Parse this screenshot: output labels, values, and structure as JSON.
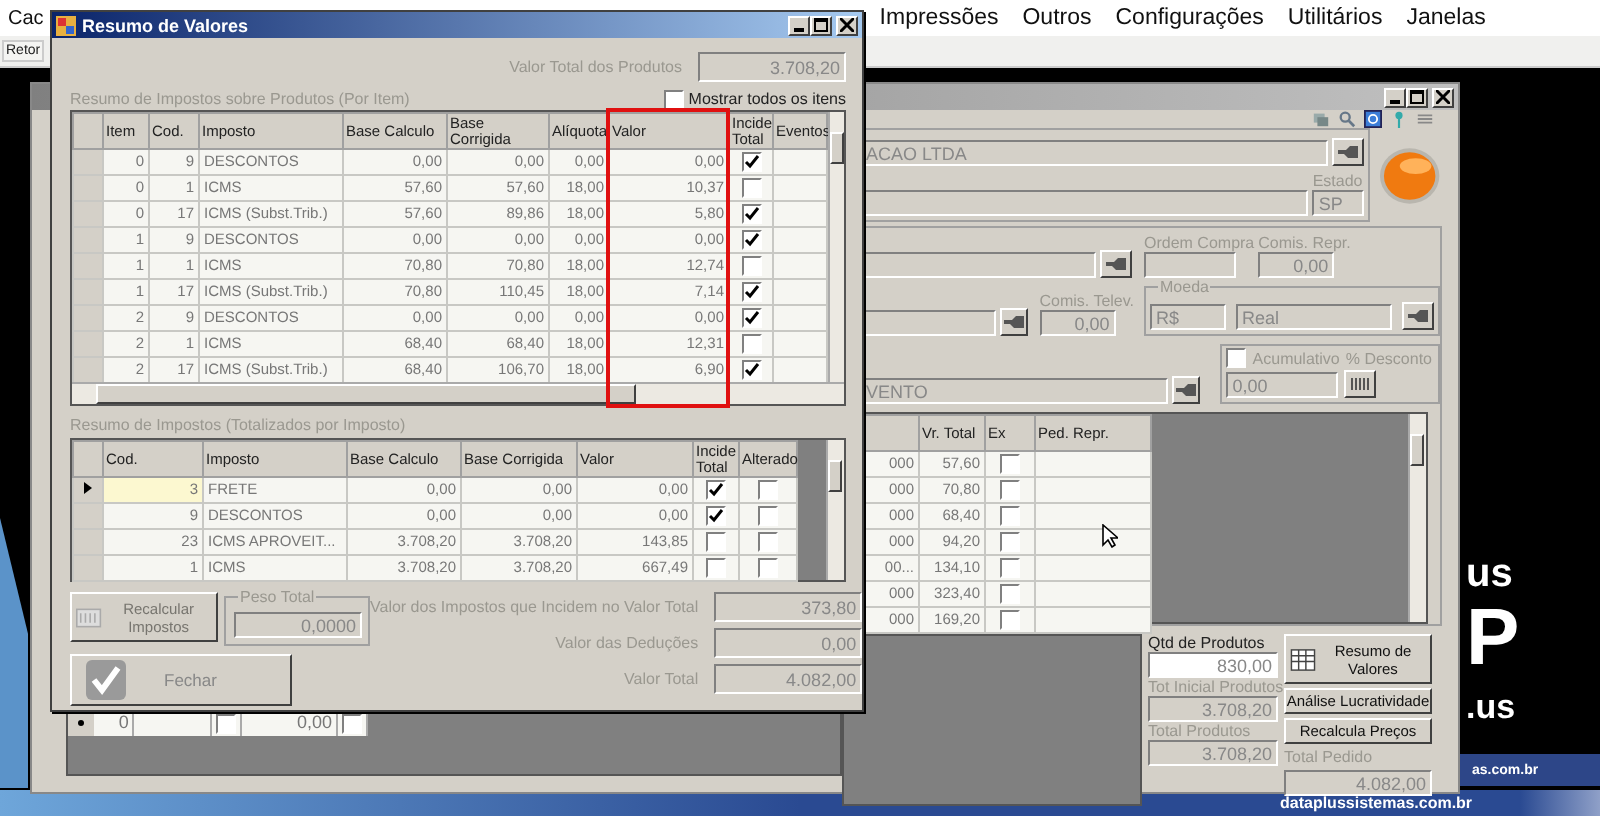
{
  "app": {
    "menu_cut": "Cac",
    "menu": [
      "Impressões",
      "Outros",
      "Configurações",
      "Utilitários",
      "Janelas"
    ],
    "toolbar_button": "Retor"
  },
  "wallpaper": {
    "logo_top": "us",
    "logo_mid": "P",
    "logo_bottom": ".us",
    "band_text": "as.com.br",
    "footer": "dataplussistemas.com.br"
  },
  "order_window": {
    "company": "ACAO LTDA",
    "estado_label": "Estado",
    "estado": "SP",
    "ordem_compra_label": "Ordem Compra",
    "comis_repr_label": "Comis. Repr.",
    "comis_repr": "0,00",
    "comis_telev_label": "Comis. Telev.",
    "comis_telev": "0,00",
    "moeda_label": "Moeda",
    "moeda_code": "R$",
    "moeda_name": "Real",
    "field_cut": "VENTO",
    "acumulativo": {
      "label": "Acumulativo",
      "checked": false
    },
    "desconto_label": "% Desconto",
    "desconto": "0,00",
    "grid": {
      "columns": [
        "Vr. Total",
        "Ex",
        "Ped. Repr."
      ],
      "rows": [
        {
          "column_1": "000",
          "total": "57,60",
          "ex": false
        },
        {
          "column_1": "000",
          "total": "70,80",
          "ex": false
        },
        {
          "column_1": "000",
          "total": "68,40",
          "ex": false
        },
        {
          "column_1": "000",
          "total": "94,20",
          "ex": false
        },
        {
          "column_1": "00...",
          "total": "134,10",
          "ex": false
        },
        {
          "column_1": "000",
          "total": "323,40",
          "ex": false
        },
        {
          "column_1": "000",
          "total": "169,20",
          "ex": false
        }
      ]
    },
    "lower_row": {
      "value": "0",
      "check_1": false,
      "amount": "0,00",
      "check_2": false
    },
    "qtd_label": "Qtd de Produtos",
    "qtd": "830,00",
    "tot_inicial_label": "Tot Inicial Produtos",
    "tot_inicial": "3.708,20",
    "total_produtos_label": "Total Produtos",
    "total_produtos": "3.708,20",
    "total_pedido_label": "Total Pedido",
    "total_pedido": "4.082,00",
    "buttons": {
      "resumo": "Resumo de Valores",
      "analise": "Análise Lucratividade",
      "recalcula": "Recalcula Preços"
    }
  },
  "dialog": {
    "title": "Resumo de Valores",
    "total_label": "Valor Total dos Produtos",
    "total": "3.708,20",
    "items_title": "Resumo de Impostos sobre Produtos (Por Item)",
    "show_all": {
      "label": "Mostrar todos os itens",
      "checked": false
    },
    "items_columns": [
      "Item",
      "Cod.",
      "Imposto",
      "Base Calculo",
      "Base Corrigida",
      "Alíquota",
      "Valor",
      "Incide Total",
      "Eventos"
    ],
    "items": [
      {
        "item": "0",
        "cod": "9",
        "imposto": "DESCONTOS",
        "base": "0,00",
        "corrigida": "0,00",
        "aliquota": "0,00",
        "valor": "0,00",
        "incide": true
      },
      {
        "item": "0",
        "cod": "1",
        "imposto": "ICMS",
        "base": "57,60",
        "corrigida": "57,60",
        "aliquota": "18,00",
        "valor": "10,37",
        "incide": false
      },
      {
        "item": "0",
        "cod": "17",
        "imposto": "ICMS (Subst.Trib.)",
        "base": "57,60",
        "corrigida": "89,86",
        "aliquota": "18,00",
        "valor": "5,80",
        "incide": true
      },
      {
        "item": "1",
        "cod": "9",
        "imposto": "DESCONTOS",
        "base": "0,00",
        "corrigida": "0,00",
        "aliquota": "0,00",
        "valor": "0,00",
        "incide": true
      },
      {
        "item": "1",
        "cod": "1",
        "imposto": "ICMS",
        "base": "70,80",
        "corrigida": "70,80",
        "aliquota": "18,00",
        "valor": "12,74",
        "incide": false
      },
      {
        "item": "1",
        "cod": "17",
        "imposto": "ICMS (Subst.Trib.)",
        "base": "70,80",
        "corrigida": "110,45",
        "aliquota": "18,00",
        "valor": "7,14",
        "incide": true
      },
      {
        "item": "2",
        "cod": "9",
        "imposto": "DESCONTOS",
        "base": "0,00",
        "corrigida": "0,00",
        "aliquota": "0,00",
        "valor": "0,00",
        "incide": true
      },
      {
        "item": "2",
        "cod": "1",
        "imposto": "ICMS",
        "base": "68,40",
        "corrigida": "68,40",
        "aliquota": "18,00",
        "valor": "12,31",
        "incide": false
      },
      {
        "item": "2",
        "cod": "17",
        "imposto": "ICMS (Subst.Trib.)",
        "base": "68,40",
        "corrigida": "106,70",
        "aliquota": "18,00",
        "valor": "6,90",
        "incide": true
      }
    ],
    "totals_title": "Resumo de Impostos (Totalizados por Imposto)",
    "totals_columns": [
      "Cod.",
      "Imposto",
      "Base Calculo",
      "Base Corrigida",
      "Valor",
      "Incide Total",
      "Alterado"
    ],
    "totals_rows": [
      {
        "cod": "3",
        "imposto": "FRETE",
        "base": "0,00",
        "corrigida": "0,00",
        "valor": "0,00",
        "incide": true,
        "alterado": false,
        "selected": true
      },
      {
        "cod": "9",
        "imposto": "DESCONTOS",
        "base": "0,00",
        "corrigida": "0,00",
        "valor": "0,00",
        "incide": true,
        "alterado": false,
        "selected": false
      },
      {
        "cod": "23",
        "imposto": "ICMS APROVEIT...",
        "base": "3.708,20",
        "corrigida": "3.708,20",
        "valor": "143,85",
        "incide": false,
        "alterado": false,
        "selected": false
      },
      {
        "cod": "1",
        "imposto": "ICMS",
        "base": "3.708,20",
        "corrigida": "3.708,20",
        "valor": "667,49",
        "incide": false,
        "alterado": false,
        "selected": false
      }
    ],
    "recalcular": {
      "label": "Recalcular Impostos",
      "disabled": true
    },
    "peso_label": "Peso Total",
    "peso": "0,0000",
    "fechar": "Fechar",
    "summary": [
      {
        "label": "Valor dos Impostos que Incidem no Valor Total",
        "value": "373,80"
      },
      {
        "label": "Valor das Deduções",
        "value": "0,00"
      },
      {
        "label": "Valor Total",
        "value": "4.082,00"
      }
    ]
  }
}
